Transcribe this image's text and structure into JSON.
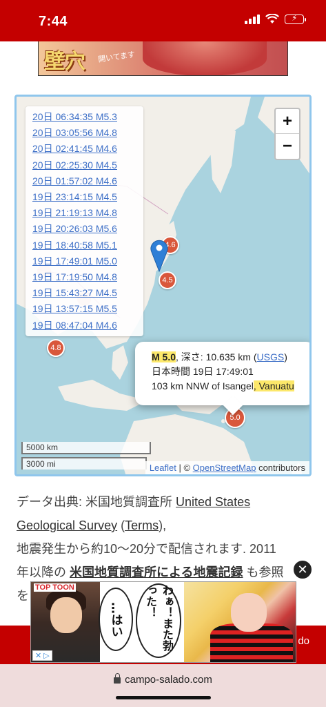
{
  "status_bar": {
    "time": "7:44"
  },
  "top_banner": {
    "title": "壁穴",
    "subtitle": "開いてます"
  },
  "map": {
    "zoom_in": "+",
    "zoom_out": "−",
    "quake_list": [
      "20日 06:34:35 M5.3",
      "20日 03:05:56 M4.8",
      "20日 02:41:45 M4.6",
      "20日 02:25:30 M4.5",
      "20日 01:57:02 M4.6",
      "19日 23:14:15 M4.5",
      "19日 21:19:13 M4.8",
      "19日 20:26:03 M5.6",
      "19日 18:40:58 M5.1",
      "19日 17:49:01 M5.0",
      "19日 17:19:50 M4.8",
      "19日 15:43:27 M4.5",
      "19日 13:57:15 M5.5",
      "19日 08:47:04 M4.6"
    ],
    "markers": [
      "4.6",
      "4.5",
      "4.8",
      "5.0"
    ],
    "popup": {
      "magnitude": "M 5.0",
      "depth_label": ", 深さ: 10.635 km (",
      "source_link": "USGS",
      "depth_close": ")",
      "time_line": "日本時間 19日 17:49:01",
      "location_a": "103 km NNW of Isangel",
      "location_b": ", Vanuatu"
    },
    "scale_km": "5000 km",
    "scale_mi": "3000 mi",
    "attribution": {
      "leaflet": "Leaflet",
      "sep": " | © ",
      "osm": "OpenStreetMap",
      "suffix": " contributors"
    }
  },
  "article": {
    "line1_prefix": "データ出典: 米国地質調査所 ",
    "usgs_link_a": "United States",
    "usgs_link_b": "Geological Survey",
    "paren_open": " (",
    "terms_link": "Terms",
    "paren_close": "),",
    "line3": "地震発生から約10〜20分で配信されます. 2011",
    "line4_prefix": "年以降の ",
    "records_link": "米国地質調査所による地震記録",
    "line4_suffix": " も参照",
    "line5": "を"
  },
  "close_ad": "✕",
  "red_bar_text": "do",
  "bottom_ad": {
    "brand": "TOP TOON",
    "bubble_a": "…はい",
    "bubble_b": "わぁ！また勃った！",
    "choice": "✕ ▷"
  },
  "url_bar": {
    "domain": "campo-salado.com"
  }
}
